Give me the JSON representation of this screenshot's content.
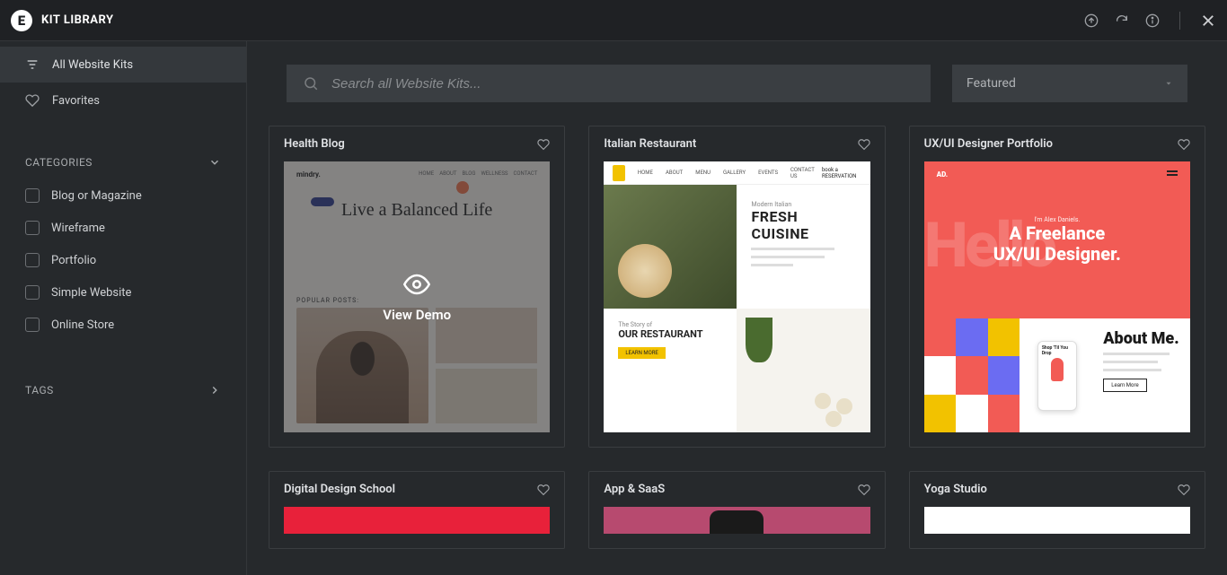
{
  "header": {
    "logo_glyph": "E",
    "title": "KIT LIBRARY"
  },
  "sidebar": {
    "nav": [
      {
        "label": "All Website Kits",
        "icon": "filter-icon",
        "active": true
      },
      {
        "label": "Favorites",
        "icon": "heart-icon",
        "active": false
      }
    ],
    "categories_title": "CATEGORIES",
    "categories": [
      "Blog or Magazine",
      "Wireframe",
      "Portfolio",
      "Simple Website",
      "Online Store"
    ],
    "tags_title": "TAGS"
  },
  "controls": {
    "search_placeholder": "Search all Website Kits...",
    "sort_selected": "Featured"
  },
  "kits": [
    {
      "title": "Health Blog",
      "hovered": true,
      "overlay_label": "View Demo"
    },
    {
      "title": "Italian Restaurant",
      "hovered": false
    },
    {
      "title": "UX/UI Designer Portfolio",
      "hovered": false
    },
    {
      "title": "Digital Design School",
      "hovered": false
    },
    {
      "title": "App & SaaS",
      "hovered": false
    },
    {
      "title": "Yoga Studio",
      "hovered": false
    }
  ],
  "thumbs": {
    "t1": {
      "brand": "mindry.",
      "hero": "Live a Balanced Life",
      "popular": "POPULAR POSTS:"
    },
    "t2": {
      "fresh_sm": "Modern Italian",
      "fresh": "FRESH CUISINE",
      "story_sm": "The Story of",
      "story": "OUR RESTAURANT",
      "btn": "LEARN MORE"
    },
    "t3": {
      "brand": "AD.",
      "small": "I'm Alex Daniels.",
      "big1": "A Freelance",
      "big2": "UX/UI Designer.",
      "about": "About Me.",
      "shop": "Shop 'Til You Drop",
      "btn": "Learn More"
    }
  }
}
